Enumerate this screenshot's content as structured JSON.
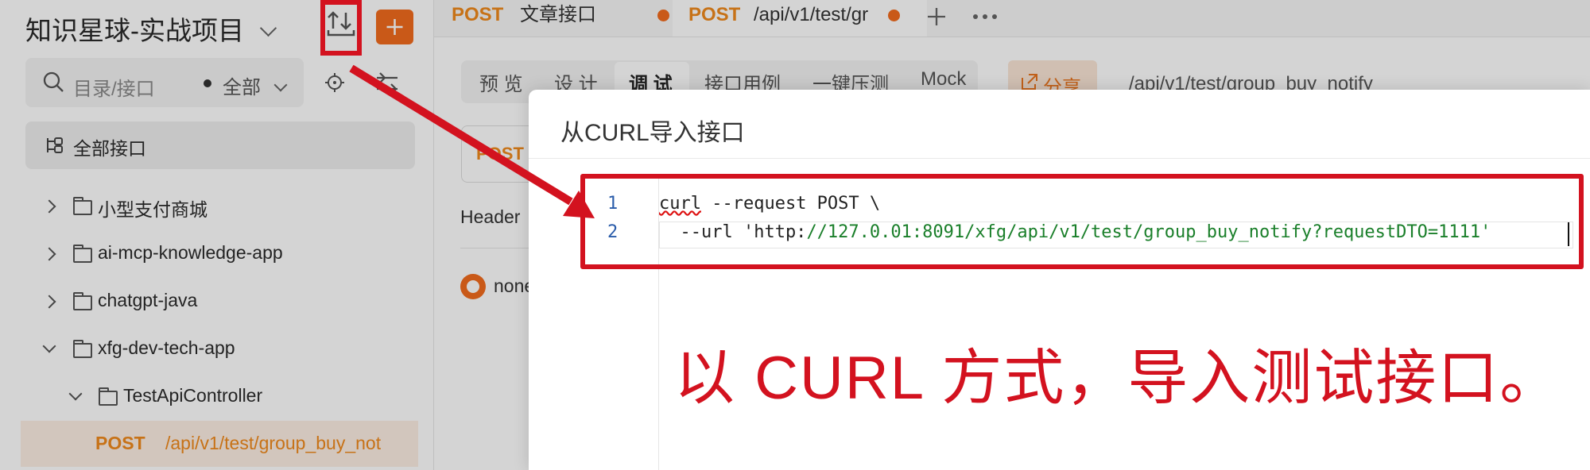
{
  "sidebar": {
    "project_title": "知识星球-实战项目",
    "search_placeholder": "目录/接口",
    "scope_label": "全部",
    "all_apis_label": "全部接口",
    "tree": [
      {
        "label": "小型支付商城",
        "expanded": false
      },
      {
        "label": "ai-mcp-knowledge-app",
        "expanded": false
      },
      {
        "label": "chatgpt-java",
        "expanded": false
      },
      {
        "label": "xfg-dev-tech-app",
        "expanded": true
      },
      {
        "label": "TestApiController",
        "expanded": true
      }
    ],
    "selected_api": {
      "method": "POST",
      "path": "/api/v1/test/group_buy_not"
    }
  },
  "tabs": [
    {
      "method": "POST",
      "label": "文章接口"
    },
    {
      "method": "POST",
      "label": "/api/v1/test/gr"
    }
  ],
  "subtabs": [
    "预 览",
    "设 计",
    "调 试",
    "接口用例",
    "一键压测",
    "Mock"
  ],
  "active_subtab": "调 试",
  "share_label": "分享",
  "url_breadcrumb": "/api/v1/test/group_buy_notify",
  "background": {
    "method_tag": "POST",
    "header_label": "Header",
    "none_label": "none"
  },
  "modal": {
    "title": "从CURL导入接口",
    "code_lines": [
      {
        "number": "1",
        "text_a": "curl",
        "text_b": " --request POST \\"
      },
      {
        "number": "2",
        "text_a": "  --url 'http:",
        "text_b": "//127.0.01:8091/xfg/api/v1/test/group_buy_notify?requestDTO=1111'"
      }
    ]
  },
  "annotation_text": "以 CURL 方式，导入测试接口。",
  "colors": {
    "accent": "#f26b1d",
    "annotation_red": "#d3121f",
    "url_green": "#1a7f2a"
  }
}
